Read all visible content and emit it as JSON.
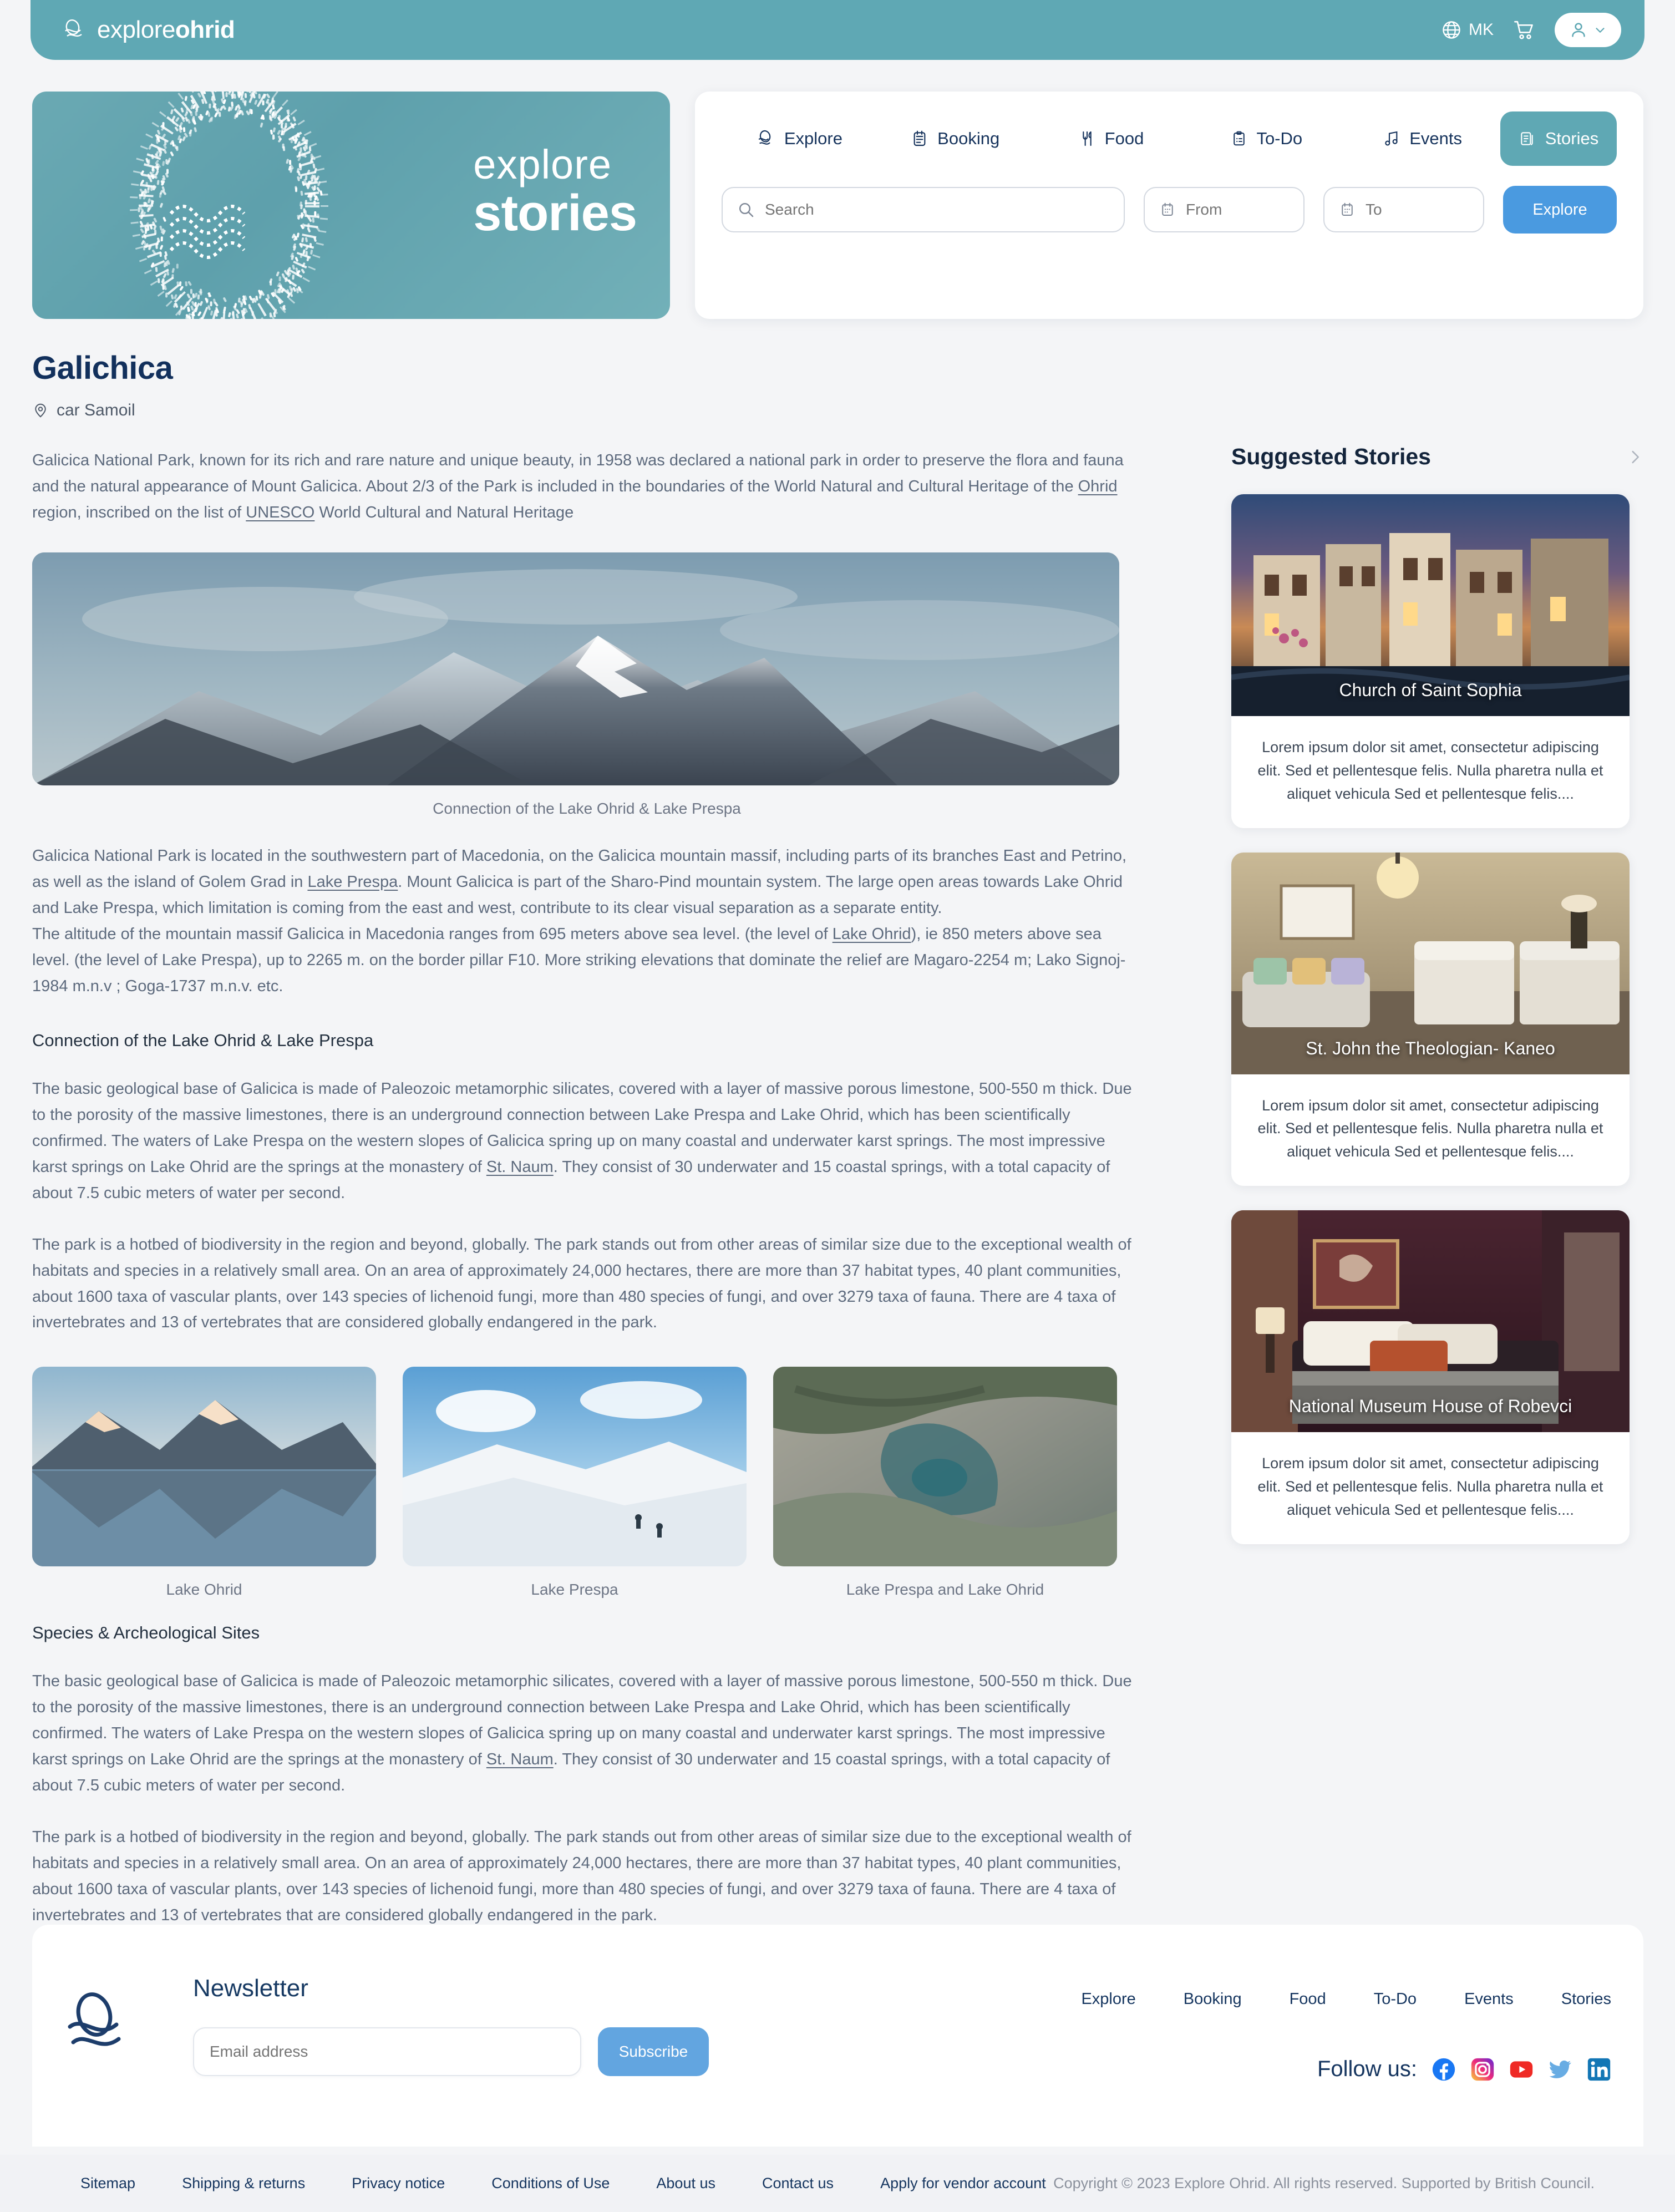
{
  "header": {
    "brand_light": "explore",
    "brand_bold": "ohrid",
    "language": "MK",
    "icons": {
      "globe": "globe-icon",
      "cart": "cart-icon",
      "user": "user-icon",
      "chevron": "chevron-down-icon"
    }
  },
  "hero": {
    "word1": "explore",
    "word2": "stories"
  },
  "nav": {
    "tabs": [
      {
        "label": "Explore",
        "icon": "explore-icon",
        "active": false
      },
      {
        "label": "Booking",
        "icon": "booking-icon",
        "active": false
      },
      {
        "label": "Food",
        "icon": "food-icon",
        "active": false
      },
      {
        "label": "To-Do",
        "icon": "todo-icon",
        "active": false
      },
      {
        "label": "Events",
        "icon": "events-icon",
        "active": false
      },
      {
        "label": "Stories",
        "icon": "stories-icon",
        "active": true
      }
    ],
    "search_placeholder": "Search",
    "from_placeholder": "From",
    "to_placeholder": "To",
    "explore_button": "Explore"
  },
  "article": {
    "title": "Galichica",
    "location": "car Samoil",
    "lead_1": "Galicica National Park, known for its rich and rare nature and unique beauty, in 1958 was declared a national park in order to preserve the flora and fauna and the natural appearance of Mount Galicica. About 2/3 of the Park is included in the boundaries of the World Natural and Cultural Heritage of the ",
    "lead_link": "Ohrid",
    "lead_2": " region, inscribed on the list of ",
    "lead_link2": "UNESCO",
    "lead_3": " World Cultural and Natural Heritage",
    "hero_caption": "Connection of the Lake Ohrid & Lake Prespa",
    "p1_a": "Galicica National Park is located in the southwestern part of Macedonia, on the Galicica mountain massif, including parts of its branches East and Petrino, as well as the island of Golem Grad in ",
    "p1_link": "Lake Prespa",
    "p1_b": ". Mount Galicica is part of the Sharo-Pind mountain system. The large open areas towards Lake Ohrid and Lake Prespa, which limitation is coming from the east and west, contribute to its clear visual separation as a separate entity.",
    "p2_a": "The altitude of the mountain massif Galicica in Macedonia ranges from 695 meters above sea level. (the level of ",
    "p2_link": "Lake Ohrid",
    "p2_b": "), ie 850 meters above sea level. (the level of Lake Prespa), up to 2265 m. on the border pillar F10. More striking elevations that dominate the relief are Magaro-2254 m; Lako Signoj-1984 m.n.v ; Goga-1737 m.n.v. etc.",
    "section_1_heading": "Connection of the Lake Ohrid & Lake Prespa",
    "s1_p1_a": "The basic geological base of Galicica is made of Paleozoic metamorphic silicates, covered with a layer of massive porous limestone, 500-550 m thick. Due to the porosity of the massive limestones, there is an underground connection between Lake Prespa and Lake Ohrid, which has been scientifically confirmed. The waters of Lake Prespa on the western slopes of Galicica spring up on many coastal and underwater karst springs. The most impressive karst springs on Lake Ohrid are the springs at the monastery of ",
    "s1_p1_link": "St. Naum",
    "s1_p1_b": ". They consist of 30 underwater and 15 coastal springs, with a total capacity of about 7.5 cubic meters of water per second.",
    "s1_p2": "The park is a hotbed of biodiversity in the region and beyond, globally. The park stands out from other areas of similar size due to the exceptional wealth of habitats and species in a relatively small area. On an area of approximately 24,000 hectares, there are more than 37 habitat types, 40 plant communities, about 1600 taxa of vascular plants, over 143 species of lichenoid fungi, more than 480 species of fungi, and over 3279 taxa of fauna. There are 4 taxa of invertebrates and 13 of vertebrates that are considered globally endangered in the park.",
    "thumbs": [
      {
        "caption": "Lake Ohrid"
      },
      {
        "caption": "Lake Prespa"
      },
      {
        "caption": "Lake Prespa and Lake Ohrid"
      }
    ],
    "section_2_heading": "Species & Archeological Sites",
    "s2_p1_a": "The basic geological base of Galicica is made of Paleozoic metamorphic silicates, covered with a layer of massive porous limestone, 500-550 m thick. Due to the porosity of the massive limestones, there is an underground connection between Lake Prespa and Lake Ohrid, which has been scientifically confirmed. The waters of Lake Prespa on the western slopes of Galicica spring up on many coastal and underwater karst springs. The most impressive karst springs on Lake Ohrid are the springs at the monastery of ",
    "s2_p1_link": "St. Naum",
    "s2_p1_b": ". They consist of 30 underwater and 15 coastal springs, with a total capacity of about 7.5 cubic meters of water per second.",
    "s2_p2": "The park is a hotbed of biodiversity in the region and beyond, globally. The park stands out from other areas of similar size due to the exceptional wealth of habitats and species in a relatively small area. On an area of approximately 24,000 hectares, there are more than 37 habitat types, 40 plant communities, about 1600 taxa of vascular plants, over 143 species of lichenoid fungi, more than 480 species of fungi, and over 3279 taxa of fauna. There are 4 taxa of invertebrates and 13 of vertebrates that are considered globally endangered in the park."
  },
  "suggested": {
    "title": "Suggested Stories",
    "next_icon": "chevron-right-icon",
    "cards": [
      {
        "label": "Church of Saint Sophia",
        "text": "Lorem ipsum dolor sit amet, consectetur adipiscing elit. Sed et pellentesque felis. Nulla pharetra nulla et aliquet vehicula Sed et pellentesque felis...."
      },
      {
        "label": "St. John the Theologian- Kaneo",
        "text": "Lorem ipsum dolor sit amet, consectetur adipiscing elit. Sed et pellentesque felis. Nulla pharetra nulla et aliquet vehicula Sed et pellentesque felis...."
      },
      {
        "label": "National Museum House of Robevci",
        "text": "Lorem ipsum dolor sit amet, consectetur adipiscing elit. Sed et pellentesque felis. Nulla pharetra nulla et aliquet vehicula Sed et pellentesque felis...."
      }
    ]
  },
  "footer": {
    "newsletter_title": "Newsletter",
    "email_placeholder": "Email address",
    "subscribe_label": "Subscribe",
    "links": [
      "Explore",
      "Booking",
      "Food",
      "To-Do",
      "Events",
      "Stories"
    ],
    "follow_label": "Follow us:",
    "socials": [
      "facebook-icon",
      "instagram-icon",
      "youtube-icon",
      "twitter-icon",
      "linkedin-icon"
    ],
    "bottom_links": [
      "Sitemap",
      "Shipping & returns",
      "Privacy notice",
      "Conditions of Use",
      "About us",
      "Contact us",
      "Apply for vendor account"
    ],
    "copyright": "Copyright © 2023 Explore Ohrid. All rights reserved. Supported by British Council."
  },
  "colors": {
    "teal": "#5fa8b4",
    "navy": "#12305c",
    "blue": "#4a9ae0",
    "page_bg": "#f4f5f7"
  }
}
